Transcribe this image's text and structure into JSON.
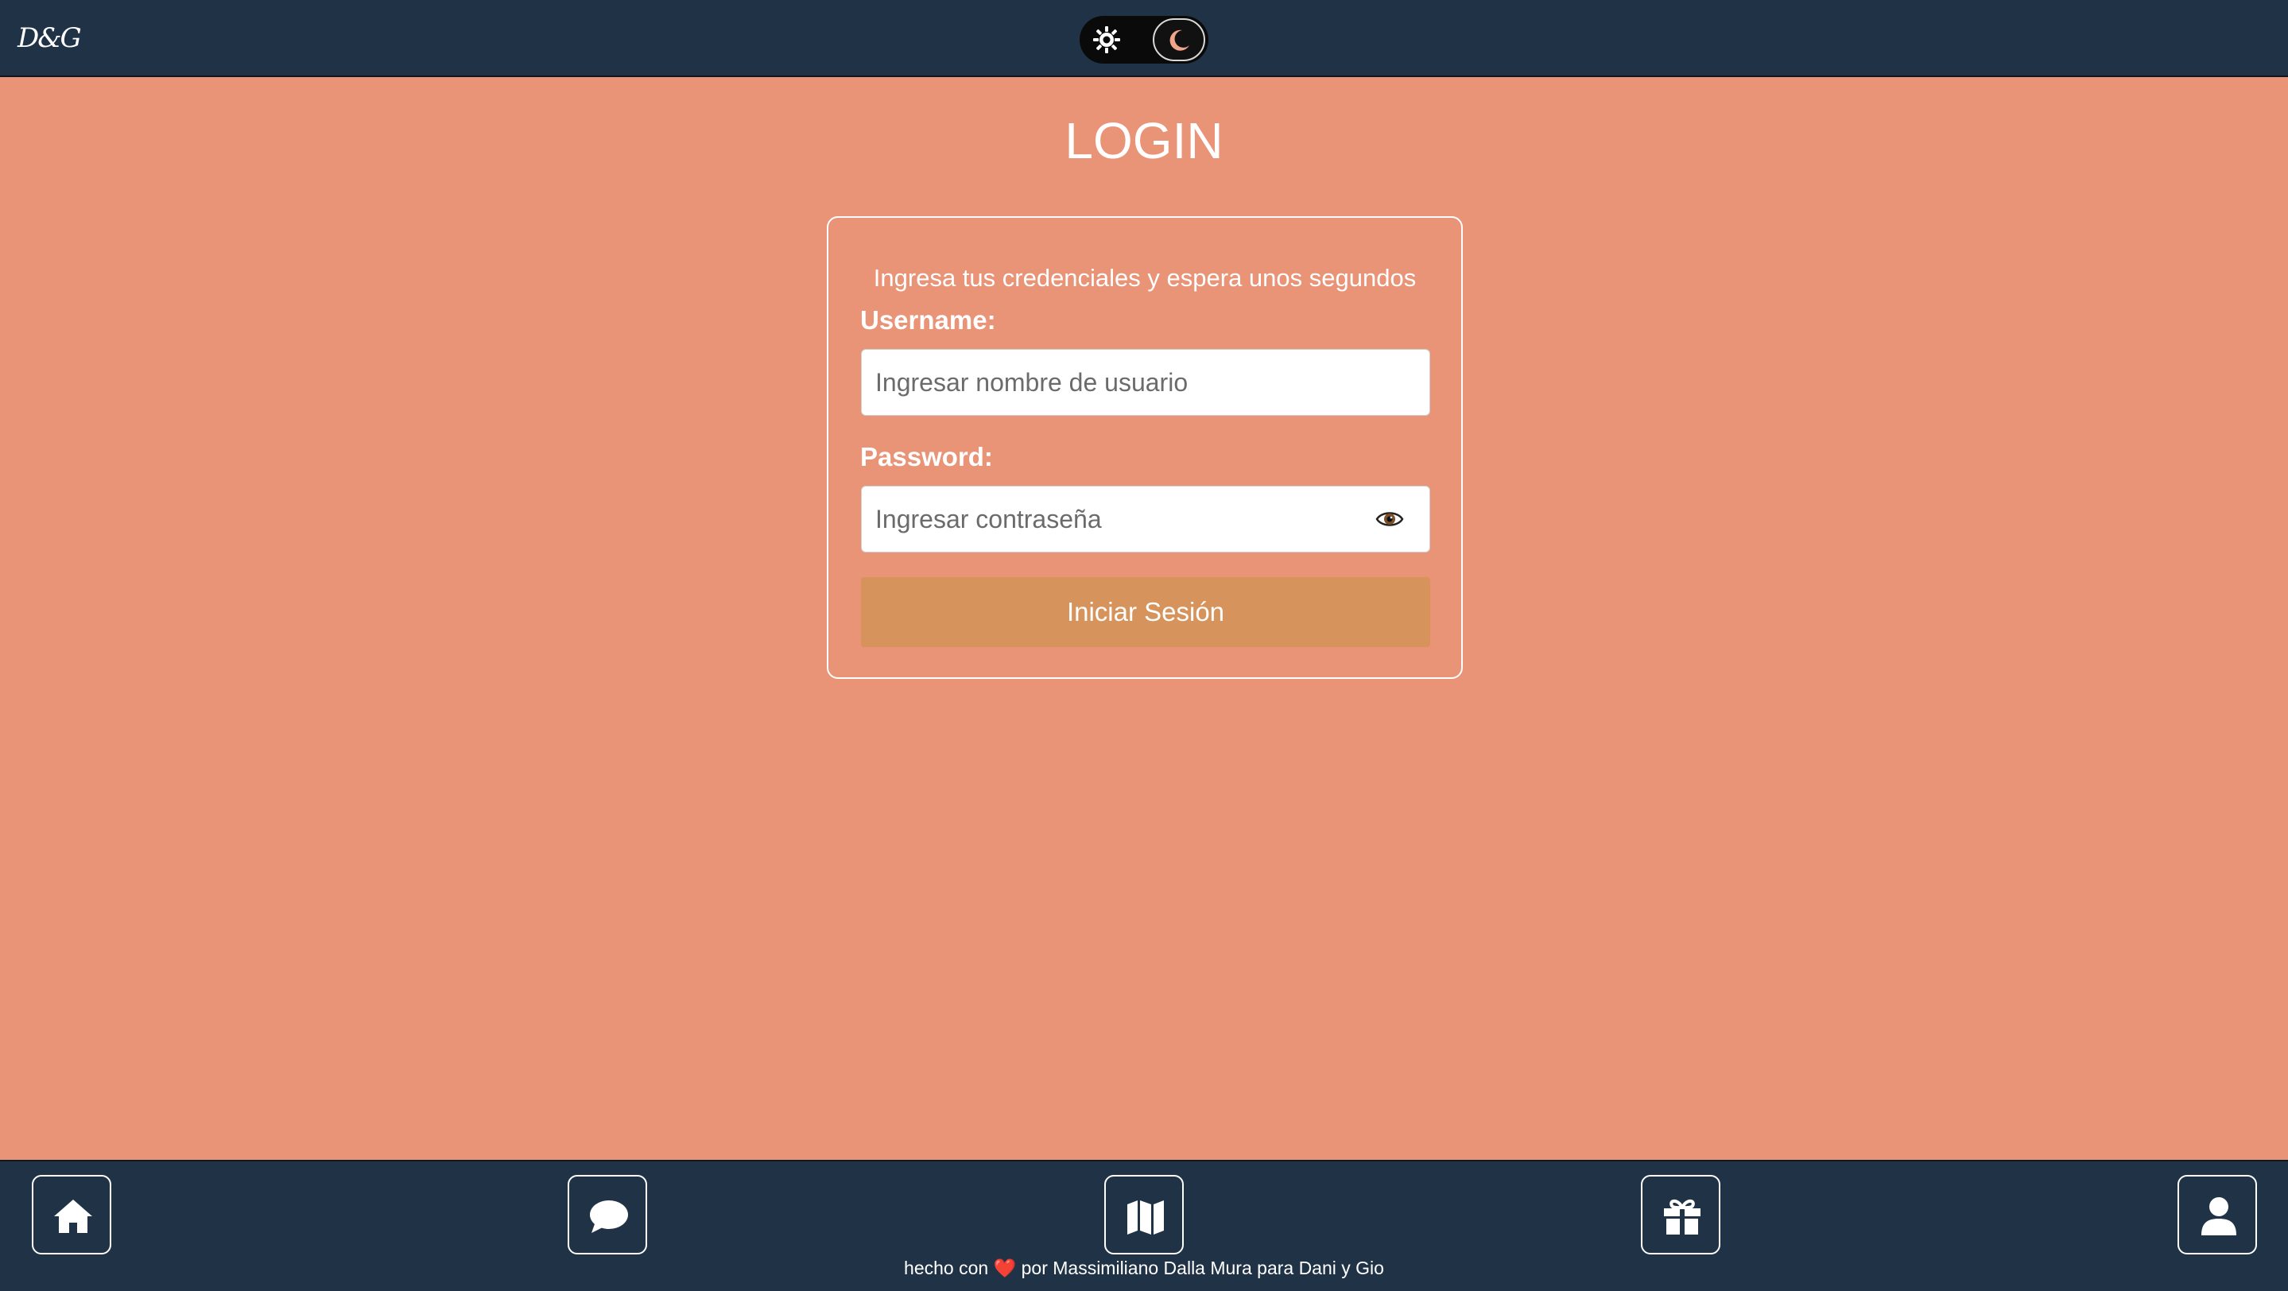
{
  "header": {
    "logo_text": "D&G",
    "theme_toggle": {
      "light_icon": "sun-icon",
      "dark_icon": "moon-icon",
      "selected": "dark"
    }
  },
  "main": {
    "title": "LOGIN",
    "instructions": "Ingresa tus credenciales y espera unos segundos",
    "username": {
      "label": "Username:",
      "placeholder": "Ingresar nombre de usuario",
      "value": ""
    },
    "password": {
      "label": "Password:",
      "placeholder": "Ingresar contraseña",
      "value": "",
      "toggle_icon": "eye-icon"
    },
    "submit_label": "Iniciar Sesión"
  },
  "bottom_nav": {
    "items": [
      {
        "icon": "home-icon"
      },
      {
        "icon": "chat-bubble-icon"
      },
      {
        "icon": "map-icon"
      },
      {
        "icon": "gift-icon"
      },
      {
        "icon": "user-icon"
      }
    ]
  },
  "footer": {
    "credit_prefix": "hecho con",
    "heart": "❤️",
    "credit_suffix": "por Massimiliano Dalla Mura para Dani y Gio"
  },
  "colors": {
    "background": "#e99377",
    "bars": "#203246",
    "button": "#d6935b",
    "text_light": "#ffffff"
  }
}
